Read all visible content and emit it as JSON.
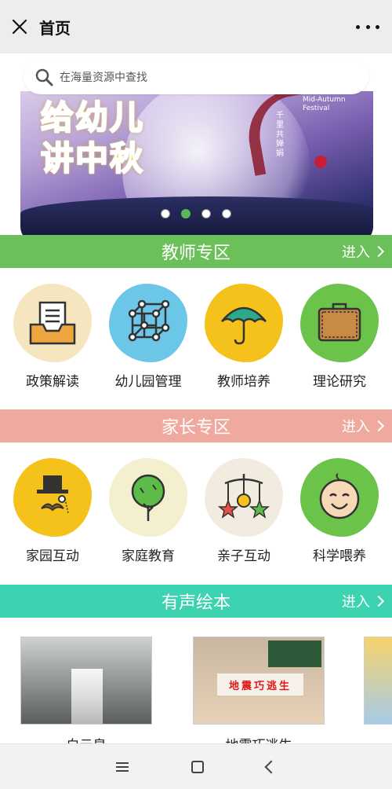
{
  "header": {
    "title": "首页"
  },
  "search": {
    "placeholder": "在海量资源中查找"
  },
  "banner": {
    "headline_line1": "给幼儿",
    "headline_line2": "讲中秋",
    "english": "Mid-Autumn Festival",
    "poem": "千里共婵娟",
    "dots": 4,
    "active_dot": 2
  },
  "sections": {
    "teacher": {
      "title": "教师专区",
      "enter": "进入",
      "items": [
        {
          "label": "政策解读",
          "icon": "document-tray-icon"
        },
        {
          "label": "幼儿园管理",
          "icon": "network-cube-icon"
        },
        {
          "label": "教师培养",
          "icon": "umbrella-icon"
        },
        {
          "label": "理论研究",
          "icon": "briefcase-icon"
        }
      ]
    },
    "parent": {
      "title": "家长专区",
      "enter": "进入",
      "items": [
        {
          "label": "家园互动",
          "icon": "gentleman-hat-icon"
        },
        {
          "label": "家庭教育",
          "icon": "tree-icon"
        },
        {
          "label": "亲子互动",
          "icon": "baby-mobile-icon"
        },
        {
          "label": "科学喂养",
          "icon": "baby-face-icon"
        }
      ]
    },
    "books": {
      "title": "有声绘本",
      "enter": "进入",
      "items": [
        {
          "title": "白云泉",
          "sign": ""
        },
        {
          "title": "地震巧逃生",
          "sign": "地震巧逃生"
        }
      ]
    }
  },
  "colors": {
    "teacher_bar": "#6cc05a",
    "parent_bar": "#f0a99e",
    "books_bar": "#3dd2b0",
    "active_dot": "#5ab75a"
  }
}
